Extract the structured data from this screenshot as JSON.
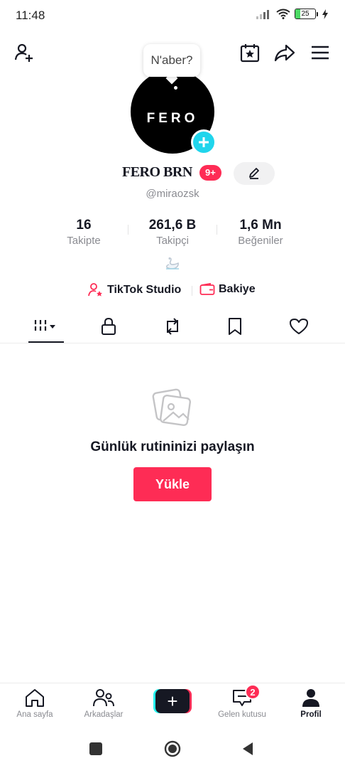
{
  "status_bar": {
    "time": "11:48",
    "battery_level": "25",
    "battery_percent": 25,
    "icons": [
      "signal-icon",
      "wifi-icon",
      "battery-icon",
      "charging-icon"
    ]
  },
  "header": {
    "icons": [
      "add-user-icon",
      "calendar-star-icon",
      "share-icon",
      "menu-icon"
    ]
  },
  "profile": {
    "note_bubble": "N'aber?",
    "avatar_text": "FERO",
    "display_name": "FERO BRN",
    "name_badge": "9+",
    "username": "@miraozsk",
    "bio_icon": "swan-icon"
  },
  "stats": [
    {
      "value": "16",
      "label": "Takipte"
    },
    {
      "value": "261,6 B",
      "label": "Takipçi"
    },
    {
      "value": "1,6 Mn",
      "label": "Beğeniler"
    }
  ],
  "links": {
    "studio": "TikTok Studio",
    "balance": "Bakiye"
  },
  "tabs": [
    "videos-grid-icon",
    "lock-icon",
    "repost-icon",
    "bookmark-icon",
    "heart-icon"
  ],
  "empty_state": {
    "title": "Günlük rutininizi paylaşın",
    "button": "Yükle"
  },
  "bottom_nav": [
    {
      "label": "Ana sayfa",
      "icon": "home-icon"
    },
    {
      "label": "Arkadaşlar",
      "icon": "friends-icon"
    },
    {
      "label": "",
      "icon": "create-plus-icon"
    },
    {
      "label": "Gelen kutusu",
      "icon": "inbox-icon",
      "badge": "2"
    },
    {
      "label": "Profil",
      "icon": "profile-icon",
      "active": true
    }
  ],
  "colors": {
    "accent": "#fe2c55",
    "cyan": "#20d5ec",
    "text": "#161823",
    "muted": "#8a8b91"
  }
}
